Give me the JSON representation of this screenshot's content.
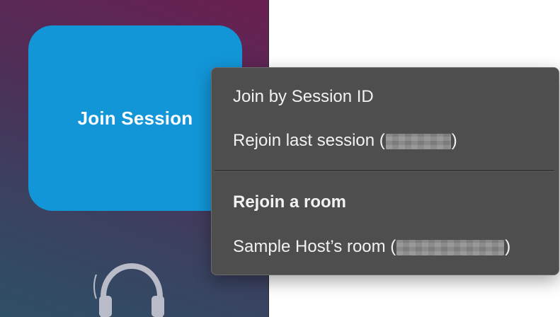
{
  "join_tile": {
    "label": "Join Session"
  },
  "context_menu": {
    "join_by_id": "Join by Session ID",
    "rejoin_last_prefix": "Rejoin last session (",
    "rejoin_last_suffix": ")",
    "rooms_header": "Rejoin a room",
    "room_item_prefix": "Sample Host’s room (",
    "room_item_suffix": ")"
  },
  "icons": {
    "headphones": "headphones-icon"
  },
  "colors": {
    "tile_blue": "#1296d8",
    "menu_bg": "#4e4e4e",
    "menu_text": "#f2f2f2"
  }
}
